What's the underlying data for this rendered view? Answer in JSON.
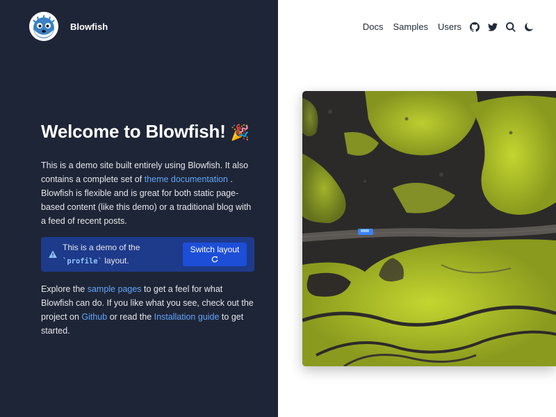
{
  "site": {
    "name": "Blowfish",
    "logo_icon": "blowfish-logo-icon"
  },
  "nav": {
    "links": [
      "Docs",
      "Samples",
      "Users"
    ],
    "icons": [
      "github-icon",
      "twitter-icon",
      "search-icon",
      "moon-icon"
    ]
  },
  "hero": {
    "title": "Welcome to Blowfish!",
    "title_emoji": "🎉",
    "intro": {
      "part1": "This is a demo site built entirely using Blowfish. It also contains a complete set of ",
      "link": "theme documentation",
      "part2": " . Blowfish is flexible and is great for both static page-based content (like this demo) or a traditional blog with a feed of recent posts."
    },
    "alert": {
      "icon": "warning-triangle-icon",
      "text_before": "This is a demo of the ",
      "code": "`profile`",
      "text_after": " layout.",
      "button_label": "Switch layout",
      "button_icon": "reload-icon"
    },
    "explore": {
      "part1": "Explore the ",
      "link1": "sample pages",
      "part2": " to get a feel for what Blowfish can do. If you like what you see, check out the project on ",
      "link2": "Github",
      "part3": " or read the ",
      "link3": "Installation guide",
      "part4": " to get started."
    },
    "image": "aerial-landscape-road-image"
  },
  "colors": {
    "panel_bg": "#1e2536",
    "accent_link": "#60a5fa",
    "alert_bg": "#1e3a8a",
    "button_bg": "#1d4ed8",
    "moss": "#b5c92a"
  }
}
